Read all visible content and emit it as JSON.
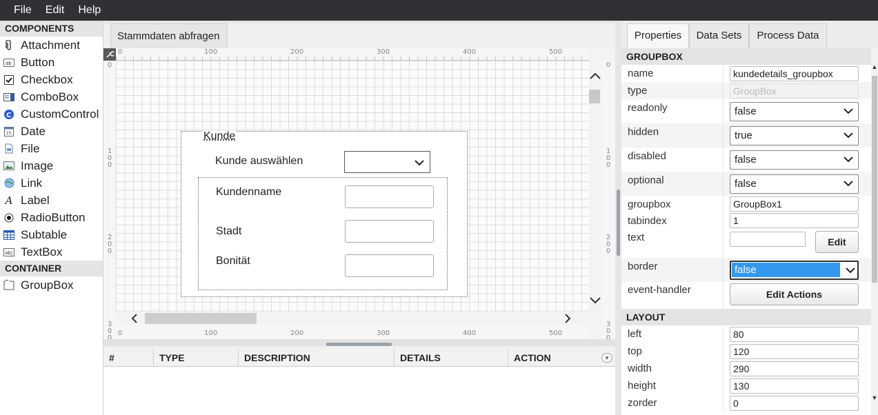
{
  "menu": [
    "File",
    "Edit",
    "Help"
  ],
  "components": {
    "header": "COMPONENTS",
    "items": [
      {
        "label": "Attachment",
        "icon": "paperclip-icon"
      },
      {
        "label": "Button",
        "icon": "button-icon"
      },
      {
        "label": "Checkbox",
        "icon": "checkbox-icon"
      },
      {
        "label": "ComboBox",
        "icon": "combobox-icon"
      },
      {
        "label": "CustomControl",
        "icon": "custom-control-icon"
      },
      {
        "label": "Date",
        "icon": "calendar-icon"
      },
      {
        "label": "File",
        "icon": "file-icon"
      },
      {
        "label": "Image",
        "icon": "image-icon"
      },
      {
        "label": "Link",
        "icon": "globe-icon"
      },
      {
        "label": "Label",
        "icon": "label-icon"
      },
      {
        "label": "RadioButton",
        "icon": "radio-icon"
      },
      {
        "label": "Subtable",
        "icon": "table-icon"
      },
      {
        "label": "TextBox",
        "icon": "textbox-icon"
      }
    ],
    "container_header": "CONTAINER",
    "container_items": [
      {
        "label": "GroupBox",
        "icon": "groupbox-icon"
      }
    ]
  },
  "designer": {
    "tab": "Stammdaten abfragen",
    "ruler_h": [
      "0",
      "100",
      "200",
      "300",
      "400",
      "500"
    ],
    "ruler_v": [
      "0",
      "100",
      "200",
      "300"
    ],
    "groupbox": {
      "title": "Kunde",
      "select_label": "Kunde auswählen",
      "fields": [
        "Kundenname",
        "Stadt",
        "Bonität"
      ]
    }
  },
  "log_table": {
    "columns": [
      "#",
      "TYPE",
      "DESCRIPTION",
      "DETAILS",
      "ACTION"
    ]
  },
  "properties": {
    "tabs": [
      "Properties",
      "Data Sets",
      "Process Data"
    ],
    "active_tab": "Properties",
    "section_groupbox": "GROUPBOX",
    "rows": {
      "name": {
        "label": "name",
        "value": "kundedetails_groupbox"
      },
      "type": {
        "label": "type",
        "value": "GroupBox"
      },
      "readonly": {
        "label": "readonly",
        "value": "false"
      },
      "hidden": {
        "label": "hidden",
        "value": "true"
      },
      "disabled": {
        "label": "disabled",
        "value": "false"
      },
      "optional": {
        "label": "optional",
        "value": "false"
      },
      "groupbox": {
        "label": "groupbox",
        "value": "GroupBox1"
      },
      "tabindex": {
        "label": "tabindex",
        "value": "1"
      },
      "text": {
        "label": "text",
        "value": "",
        "button": "Edit"
      },
      "border": {
        "label": "border",
        "value": "false"
      },
      "event_handler": {
        "label": "event-handler",
        "button": "Edit Actions"
      }
    },
    "section_layout": "LAYOUT",
    "layout": {
      "left": {
        "label": "left",
        "value": "80"
      },
      "top": {
        "label": "top",
        "value": "120"
      },
      "width": {
        "label": "width",
        "value": "290"
      },
      "height": {
        "label": "height",
        "value": "130"
      },
      "zorder": {
        "label": "zorder",
        "value": "0"
      }
    }
  },
  "colors": {
    "menubar": "#2f3134",
    "selection": "#3399ee"
  }
}
